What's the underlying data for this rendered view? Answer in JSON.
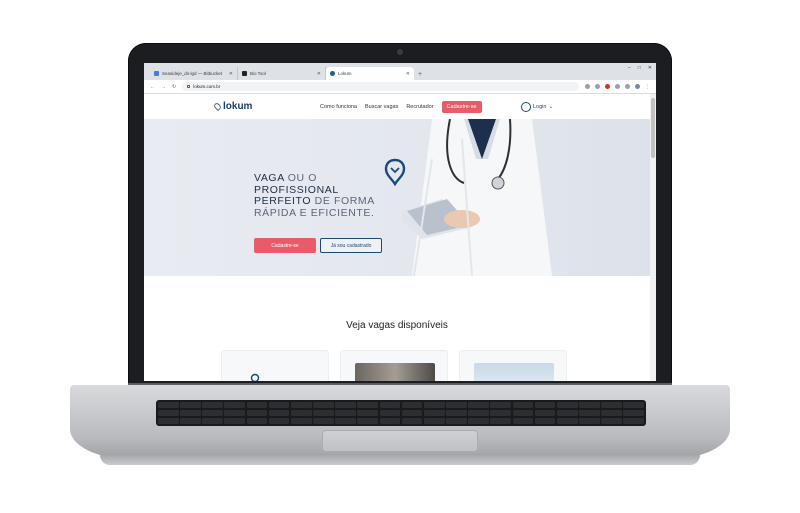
{
  "browser": {
    "tabs": [
      {
        "title": "Seasideje_ds-lgd — Bitbucket",
        "active": false
      },
      {
        "title": "Bio Tool",
        "active": false
      },
      {
        "title": "Lokum",
        "active": true
      }
    ],
    "new_tab": "+",
    "url": "lokum.com.br",
    "win_controls": [
      "–",
      "□",
      "✕"
    ]
  },
  "site": {
    "logo": "lokum",
    "nav": [
      "Como funciona",
      "Buscar vagas",
      "Recrutador"
    ],
    "cta": "Cadastre-se",
    "login": "Login",
    "hero": {
      "line1_bold": "VAGA",
      "line1_light": " OU O",
      "line2_bold": "PROFISSIONAL",
      "line3_bold": "PERFEITO",
      "line3_light": " DE FORMA",
      "line4_light": "RÁPIDA E EFICIENTE."
    },
    "hero_buttons": {
      "primary": "Cadastre-se",
      "secondary": "Já sou cadastrado"
    },
    "section_title": "Veja vagas disponíveis"
  },
  "colors": {
    "accent": "#e95b68",
    "brand": "#1b4a7a",
    "hero_bg": "#e5e9f0"
  }
}
